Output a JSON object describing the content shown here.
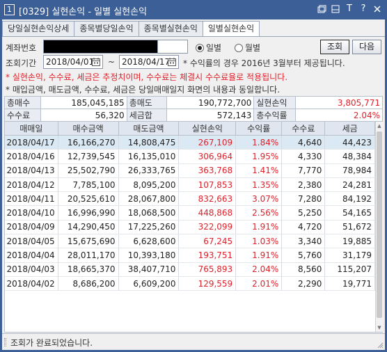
{
  "window": {
    "number": "1",
    "title": "[0329] 실현손익 - 일별 실현손익",
    "buttons": [
      "restore-icon",
      "dock-icon",
      "text-size-icon",
      "help-icon",
      "close-icon"
    ],
    "text_size_label": "T",
    "help_label": "?"
  },
  "tabs": [
    {
      "label": "당일실현손익상세",
      "active": false
    },
    {
      "label": "종목별당일손익",
      "active": false
    },
    {
      "label": "종목별실현손익",
      "active": false
    },
    {
      "label": "일별실현손익",
      "active": true
    }
  ],
  "query": {
    "account_label": "계좌번호",
    "period_label": "조회기간",
    "date_from": "2018/04/01",
    "date_to": "2018/04/17",
    "tilde": "~",
    "radio_daily": "일별",
    "radio_monthly": "월별",
    "selected": "daily",
    "search_btn": "조회",
    "next_btn": "다음",
    "period_note": "* 수익률의 경우 2016년 3월부터 제공됩니다."
  },
  "notices": {
    "line1": "* 실현손익, 수수료, 세금은 추정치이며, 수수료는 체결시 수수료율로 적용됩니다.",
    "line2": "* 매입금액, 매도금액, 수수료, 세금은 당일매매일지 화면의 내용과 동일합니다."
  },
  "summary": {
    "total_buy_label": "총매수",
    "total_buy": "185,045,185",
    "total_sell_label": "총매도",
    "total_sell": "190,772,700",
    "realized_label": "실현손익",
    "realized": "3,805,771",
    "fee_label": "수수료",
    "fee": "56,320",
    "tax_label": "세금합",
    "tax": "572,143",
    "return_label": "총수익률",
    "return": "2.04%"
  },
  "grid": {
    "columns": [
      "매매일",
      "매수금액",
      "매도금액",
      "실현손익",
      "수익률",
      "수수료",
      "세금"
    ],
    "rows": [
      [
        "2018/04/17",
        "16,166,270",
        "14,808,475",
        "267,109",
        "1.84%",
        "4,640",
        "44,423"
      ],
      [
        "2018/04/16",
        "12,739,545",
        "16,135,010",
        "306,964",
        "1.95%",
        "4,330",
        "48,384"
      ],
      [
        "2018/04/13",
        "25,502,790",
        "26,333,765",
        "363,768",
        "1.41%",
        "7,770",
        "78,984"
      ],
      [
        "2018/04/12",
        "7,785,100",
        "8,095,200",
        "107,853",
        "1.35%",
        "2,380",
        "24,281"
      ],
      [
        "2018/04/11",
        "20,525,610",
        "28,067,800",
        "832,663",
        "3.07%",
        "7,280",
        "84,192"
      ],
      [
        "2018/04/10",
        "16,996,990",
        "18,068,500",
        "448,868",
        "2.56%",
        "5,250",
        "54,165"
      ],
      [
        "2018/04/09",
        "14,290,450",
        "17,225,260",
        "322,099",
        "1.91%",
        "4,720",
        "51,672"
      ],
      [
        "2018/04/05",
        "15,675,690",
        "6,628,600",
        "67,245",
        "1.03%",
        "3,340",
        "19,885"
      ],
      [
        "2018/04/04",
        "28,011,170",
        "10,393,180",
        "193,751",
        "1.91%",
        "5,760",
        "31,179"
      ],
      [
        "2018/04/03",
        "18,665,370",
        "38,407,710",
        "765,893",
        "2.04%",
        "8,560",
        "115,207"
      ],
      [
        "2018/04/02",
        "8,686,200",
        "6,609,200",
        "129,559",
        "2.01%",
        "2,290",
        "19,771"
      ]
    ]
  },
  "status": {
    "text": "조회가 완료되었습니다."
  },
  "colors": {
    "title_bg": "#3b5f96",
    "profit_red": "#e0202a",
    "selected_row": "#dbe9f5",
    "header_bg": "#dfe6ef"
  }
}
